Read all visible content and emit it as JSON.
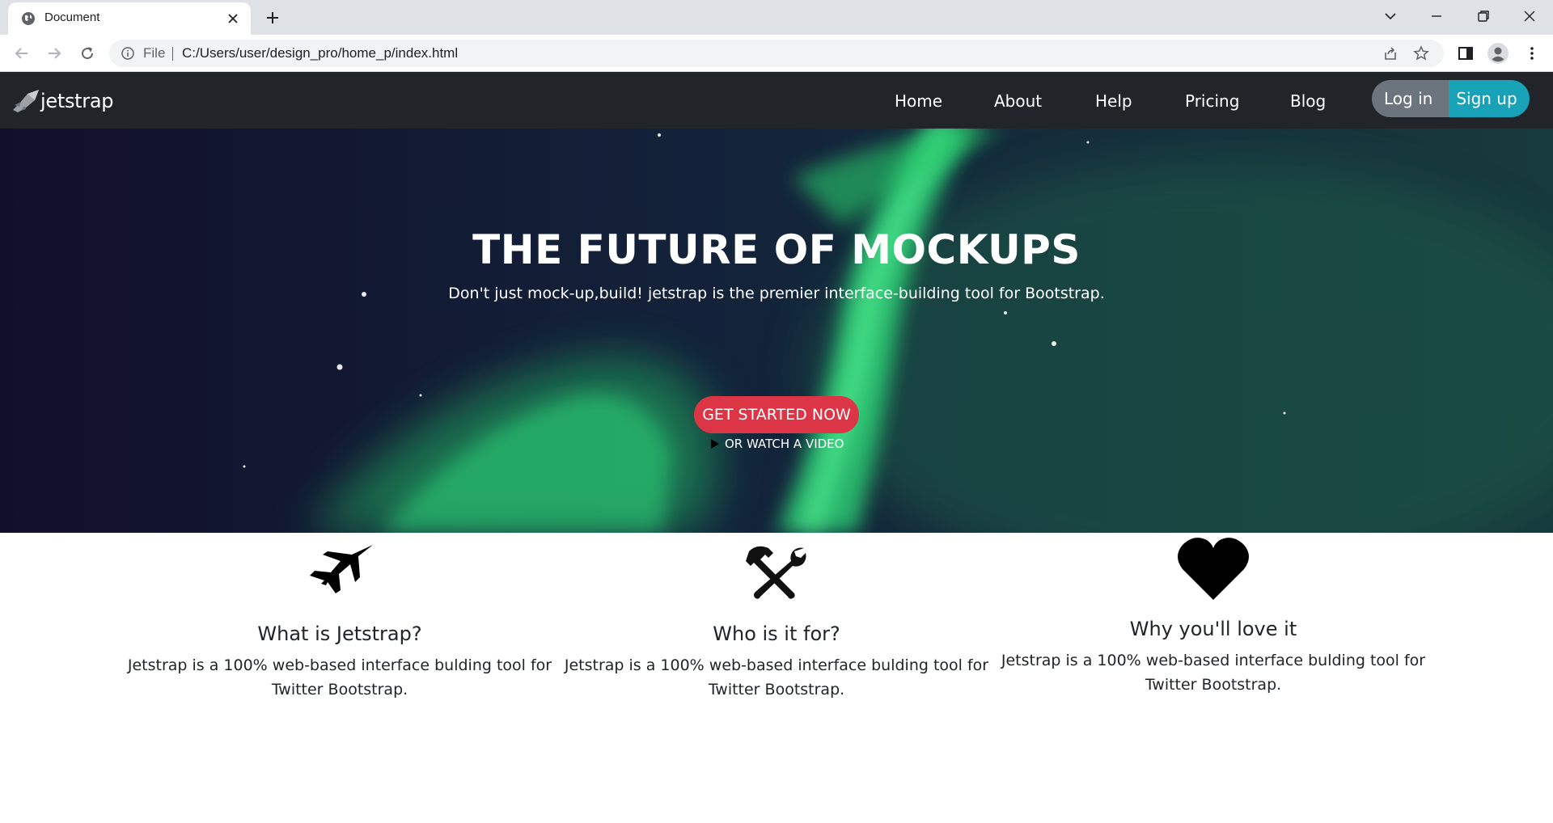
{
  "browser": {
    "tab_title": "Document",
    "scheme_label": "File",
    "url": "C:/Users/user/design_pro/home_p/index.html"
  },
  "navbar": {
    "logo_text": "jetstrap",
    "links": [
      "Home",
      "About",
      "Help",
      "Pricing",
      "Blog"
    ],
    "login_label": "Log in",
    "signup_label": "Sign up"
  },
  "hero": {
    "title": "THE FUTURE OF MOCKUPS",
    "subtitle": "Don't just mock-up,build! jetstrap is the premier interface-building tool for Bootstrap.",
    "cta_label": "GET STARTED NOW",
    "video_label": "OR WATCH A VIDEO"
  },
  "features": [
    {
      "icon": "jet-icon",
      "title": "What is Jetstrap?",
      "text": "Jetstrap is a 100% web-based interface bulding tool for Twitter Bootstrap."
    },
    {
      "icon": "tools-icon",
      "title": "Who is it for?",
      "text": "Jetstrap is a 100% web-based interface bulding tool for Twitter Bootstrap."
    },
    {
      "icon": "heart-icon",
      "title": "Why you'll love it",
      "text": "Jetstrap is a 100% web-based interface bulding tool for Twitter Bootstrap."
    }
  ],
  "colors": {
    "navbar_bg": "#212529",
    "login_bg": "#6c757d",
    "signup_bg": "#17a2b8",
    "cta_bg": "#dc3545",
    "aurora_green": "#2ee07a"
  }
}
